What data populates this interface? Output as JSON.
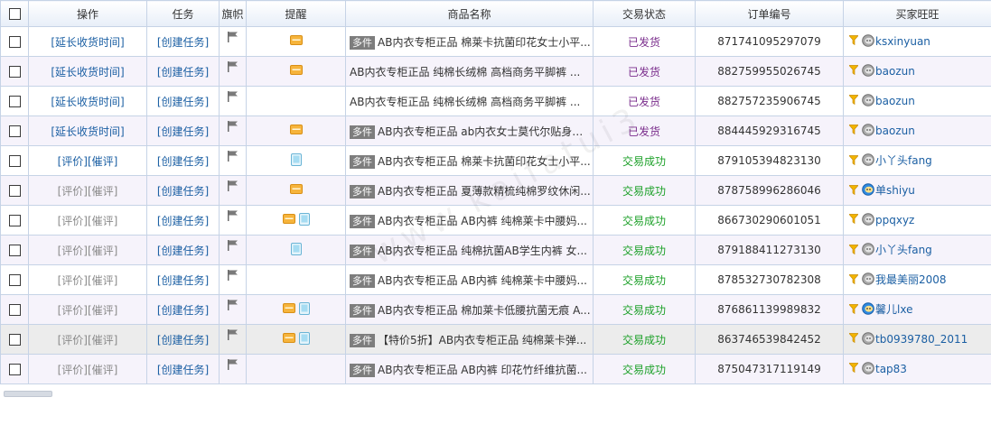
{
  "headers": {
    "operation": "操作",
    "task": "任务",
    "flag": "旗帜",
    "remind": "提醒",
    "product": "商品名称",
    "status": "交易状态",
    "order": "订单编号",
    "buyer": "买家旺旺"
  },
  "watermark": "www.kaifatui3",
  "rows": [
    {
      "op_type": "extend",
      "op": "[延长收货时间]",
      "task": "[创建任务]",
      "remind": [
        "msg"
      ],
      "tag": "多件",
      "name": "AB内衣专柜正品 棉莱卡抗菌印花女士小平...",
      "status": "已发货",
      "status_type": "shipped",
      "order": "871741095297079",
      "buyer": "ksxinyuan",
      "avatar": "gray"
    },
    {
      "op_type": "extend",
      "op": "[延长收货时间]",
      "task": "[创建任务]",
      "remind": [
        "msg"
      ],
      "tag": "",
      "name": "AB内衣专柜正品 纯棉长绒棉 高档商务平脚裤 ...",
      "status": "已发货",
      "status_type": "shipped",
      "order": "882759955026745",
      "buyer": "baozun",
      "avatar": "gray"
    },
    {
      "op_type": "extend",
      "op": "[延长收货时间]",
      "task": "[创建任务]",
      "remind": [],
      "tag": "",
      "name": "AB内衣专柜正品 纯棉长绒棉 高档商务平脚裤 ...",
      "status": "已发货",
      "status_type": "shipped",
      "order": "882757235906745",
      "buyer": "baozun",
      "avatar": "gray"
    },
    {
      "op_type": "extend",
      "op": "[延长收货时间]",
      "task": "[创建任务]",
      "remind": [
        "msg"
      ],
      "tag": "多件",
      "name": "AB内衣专柜正品 ab内衣女士莫代尔贴身圆...",
      "status": "已发货",
      "status_type": "shipped",
      "order": "884445929316745",
      "buyer": "baozun",
      "avatar": "gray"
    },
    {
      "op_type": "rate",
      "op_rate": "[评价]",
      "op_remind": "[催评]",
      "op_active": true,
      "task": "[创建任务]",
      "remind": [
        "phone"
      ],
      "tag": "多件",
      "name": "AB内衣专柜正品 棉莱卡抗菌印花女士小平...",
      "status": "交易成功",
      "status_type": "success",
      "order": "879105394823130",
      "buyer": "小丫头fang",
      "avatar": "gray"
    },
    {
      "op_type": "rate",
      "op_rate": "[评价]",
      "op_remind": "[催评]",
      "op_active": false,
      "task": "[创建任务]",
      "remind": [
        "msg"
      ],
      "tag": "多件",
      "name": "AB内衣专柜正品 夏薄款精梳纯棉罗纹休闲...",
      "status": "交易成功",
      "status_type": "success",
      "order": "878758996286046",
      "buyer": "单shiyu",
      "avatar": "blue"
    },
    {
      "op_type": "rate",
      "op_rate": "[评价]",
      "op_remind": "[催评]",
      "op_active": false,
      "task": "[创建任务]",
      "remind": [
        "msg",
        "phone"
      ],
      "tag": "多件",
      "name": "AB内衣专柜正品 AB内裤 纯棉莱卡中腰妈...",
      "status": "交易成功",
      "status_type": "success",
      "order": "866730290601051",
      "buyer": "ppqxyz",
      "avatar": "gray"
    },
    {
      "op_type": "rate",
      "op_rate": "[评价]",
      "op_remind": "[催评]",
      "op_active": false,
      "task": "[创建任务]",
      "remind": [
        "phone"
      ],
      "tag": "多件",
      "name": "AB内衣专柜正品 纯棉抗菌AB学生内裤 女...",
      "status": "交易成功",
      "status_type": "success",
      "order": "879188411273130",
      "buyer": "小丫头fang",
      "avatar": "gray"
    },
    {
      "op_type": "rate",
      "op_rate": "[评价]",
      "op_remind": "[催评]",
      "op_active": false,
      "task": "[创建任务]",
      "remind": [],
      "tag": "多件",
      "name": "AB内衣专柜正品 AB内裤 纯棉莱卡中腰妈...",
      "status": "交易成功",
      "status_type": "success",
      "order": "878532730782308",
      "buyer": "我最美丽2008",
      "avatar": "gray"
    },
    {
      "op_type": "rate",
      "op_rate": "[评价]",
      "op_remind": "[催评]",
      "op_active": false,
      "task": "[创建任务]",
      "remind": [
        "msg",
        "phone"
      ],
      "tag": "多件",
      "name": "AB内衣专柜正品 棉加莱卡低腰抗菌无痕 A...",
      "status": "交易成功",
      "status_type": "success",
      "order": "876861139989832",
      "buyer": "馨儿lxe",
      "avatar": "blue"
    },
    {
      "op_type": "rate",
      "op_rate": "[评价]",
      "op_remind": "[催评]",
      "op_active": false,
      "task": "[创建任务]",
      "remind": [
        "msg",
        "phone"
      ],
      "tag": "多件",
      "name": "【特价5折】AB内衣专柜正品 纯棉莱卡弹...",
      "status": "交易成功",
      "status_type": "success",
      "order": "863746539842452",
      "buyer": "tb0939780_2011",
      "avatar": "gray",
      "highlight": true
    },
    {
      "op_type": "rate",
      "op_rate": "[评价]",
      "op_remind": "[催评]",
      "op_active": false,
      "task": "[创建任务]",
      "remind": [],
      "tag": "多件",
      "name": "AB内衣专柜正品 AB内裤 印花竹纤维抗菌...",
      "status": "交易成功",
      "status_type": "success",
      "order": "875047317119149",
      "buyer": "tap83",
      "avatar": "gray"
    }
  ]
}
